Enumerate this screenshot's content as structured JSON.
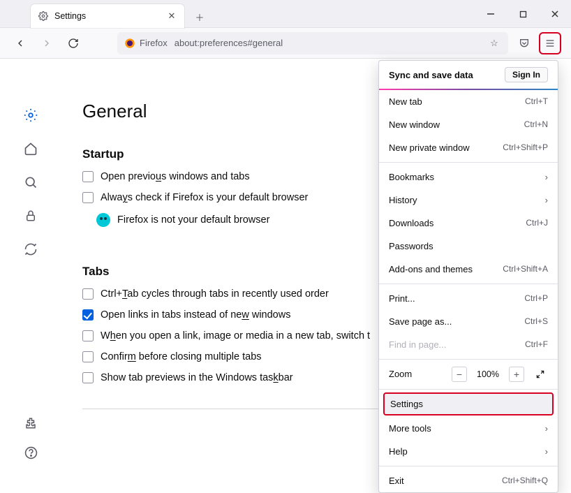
{
  "tab": {
    "title": "Settings"
  },
  "urlbar": {
    "brand": "Firefox",
    "url": "about:preferences#general"
  },
  "page": {
    "title": "General",
    "startup": {
      "heading": "Startup",
      "open_previous_pre": "Open previo",
      "open_previous_u": "u",
      "open_previous_post": "s windows and tabs",
      "always_default_pre": "Alwa",
      "always_default_u": "y",
      "always_default_post": "s check if Firefox is your default browser",
      "not_default": "Firefox is not your default browser"
    },
    "tabs": {
      "heading": "Tabs",
      "ctrltab_pre": "Ctrl+",
      "ctrltab_u": "T",
      "ctrltab_post": "ab cycles through tabs in recently used order",
      "openlinks_pre": "Open links in tabs instead of ne",
      "openlinks_u": "w",
      "openlinks_post": " windows",
      "switchto_pre": "W",
      "switchto_u": "h",
      "switchto_post": "en you open a link, image or media in a new tab, switch t",
      "confirm_pre": "Confir",
      "confirm_u": "m",
      "confirm_post": " before closing multiple tabs",
      "taskbar_pre": "Show tab previews in the Windows tas",
      "taskbar_u": "k",
      "taskbar_post": "bar"
    }
  },
  "menu": {
    "sync": "Sync and save data",
    "signin": "Sign In",
    "newtab": "New tab",
    "newtab_sc": "Ctrl+T",
    "newwin": "New window",
    "newwin_sc": "Ctrl+N",
    "newpriv": "New private window",
    "newpriv_sc": "Ctrl+Shift+P",
    "bookmarks": "Bookmarks",
    "history": "History",
    "downloads": "Downloads",
    "downloads_sc": "Ctrl+J",
    "passwords": "Passwords",
    "addons": "Add-ons and themes",
    "addons_sc": "Ctrl+Shift+A",
    "print": "Print...",
    "print_sc": "Ctrl+P",
    "savepage": "Save page as...",
    "savepage_sc": "Ctrl+S",
    "findinpage": "Find in page...",
    "findinpage_sc": "Ctrl+F",
    "zoom": "Zoom",
    "zoom_pct": "100%",
    "settings": "Settings",
    "moretools": "More tools",
    "help": "Help",
    "exit": "Exit",
    "exit_sc": "Ctrl+Shift+Q"
  }
}
